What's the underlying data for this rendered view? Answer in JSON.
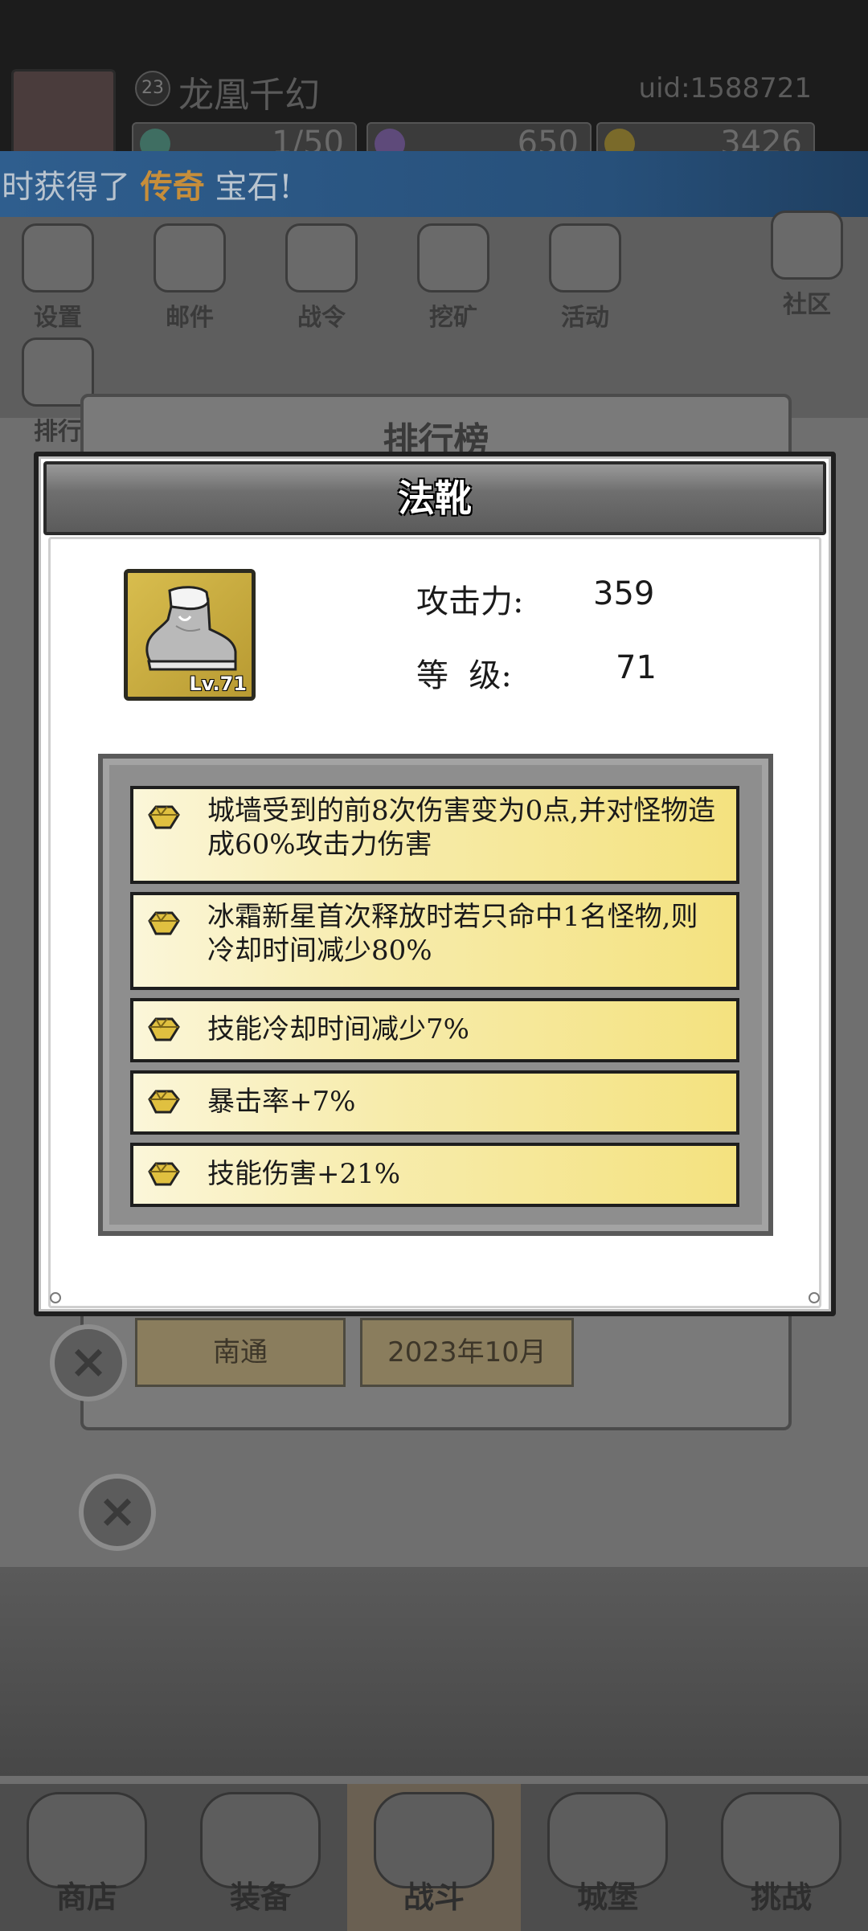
{
  "player": {
    "level": "23",
    "name": "龙凰千幻",
    "uid": "uid:1588721",
    "resources": [
      "1/50",
      "650",
      "3426"
    ]
  },
  "banner": {
    "prefix": "时获得了",
    "highlight": "传奇",
    "suffix": "宝石!"
  },
  "menu": {
    "items": [
      "设置",
      "邮件",
      "战令",
      "挖矿",
      "活动",
      "社区",
      "排行"
    ]
  },
  "rank_panel": {
    "title": "排行榜",
    "cells": [
      "南通",
      "2023年10月"
    ]
  },
  "modal": {
    "title": "法靴",
    "item_level": "Lv.71",
    "stats": [
      {
        "label": "攻击力:",
        "value": "359"
      },
      {
        "label": "等  级:",
        "value": "71"
      }
    ],
    "effects": [
      "城墙受到的前8次伤害变为0点,并对怪物造成60%攻击力伤害",
      "冰霜新星首次释放时若只命中1名怪物,则冷却时间减少80%",
      "技能冷却时间减少7%",
      "暴击率+7%",
      "技能伤害+21%"
    ]
  },
  "bottom_nav": {
    "items": [
      "商店",
      "装备",
      "战斗",
      "城堡",
      "挑战"
    ],
    "active": "战斗"
  },
  "colors": {
    "banner_bg": "#2f5e8e",
    "legend_text": "#c78e3a",
    "item_frame_gold": "#d8bd4e",
    "effect_row": "#f4e27f"
  }
}
